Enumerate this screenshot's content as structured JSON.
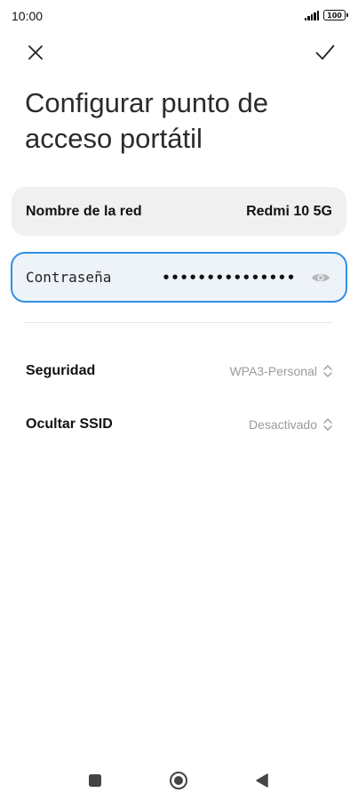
{
  "status_bar": {
    "time": "10:00",
    "battery": "100",
    "icons": [
      "signal-icon",
      "battery-icon"
    ]
  },
  "header": {
    "close_icon": "close-icon",
    "confirm_icon": "checkmark-icon"
  },
  "page": {
    "title": "Configurar punto de acceso portátil"
  },
  "network_name": {
    "label": "Nombre de la red",
    "value": "Redmi 10 5G"
  },
  "password": {
    "label": "Contraseña",
    "value_masked": "•••••••••••••••",
    "visibility_icon": "eye-icon"
  },
  "security": {
    "label": "Seguridad",
    "value": "WPA3-Personal",
    "icon": "updown-chevron-icon"
  },
  "hide_ssid": {
    "label": "Ocultar SSID",
    "value": "Desactivado",
    "icon": "updown-chevron-icon"
  },
  "nav": {
    "icons": [
      "recents-square-icon",
      "home-circle-icon",
      "back-triangle-icon"
    ]
  },
  "colors": {
    "accent": "#2f8fe8",
    "card_bg": "#f0f0f0",
    "focused_bg": "#eef3f9",
    "muted_text": "#9a9a9a"
  }
}
